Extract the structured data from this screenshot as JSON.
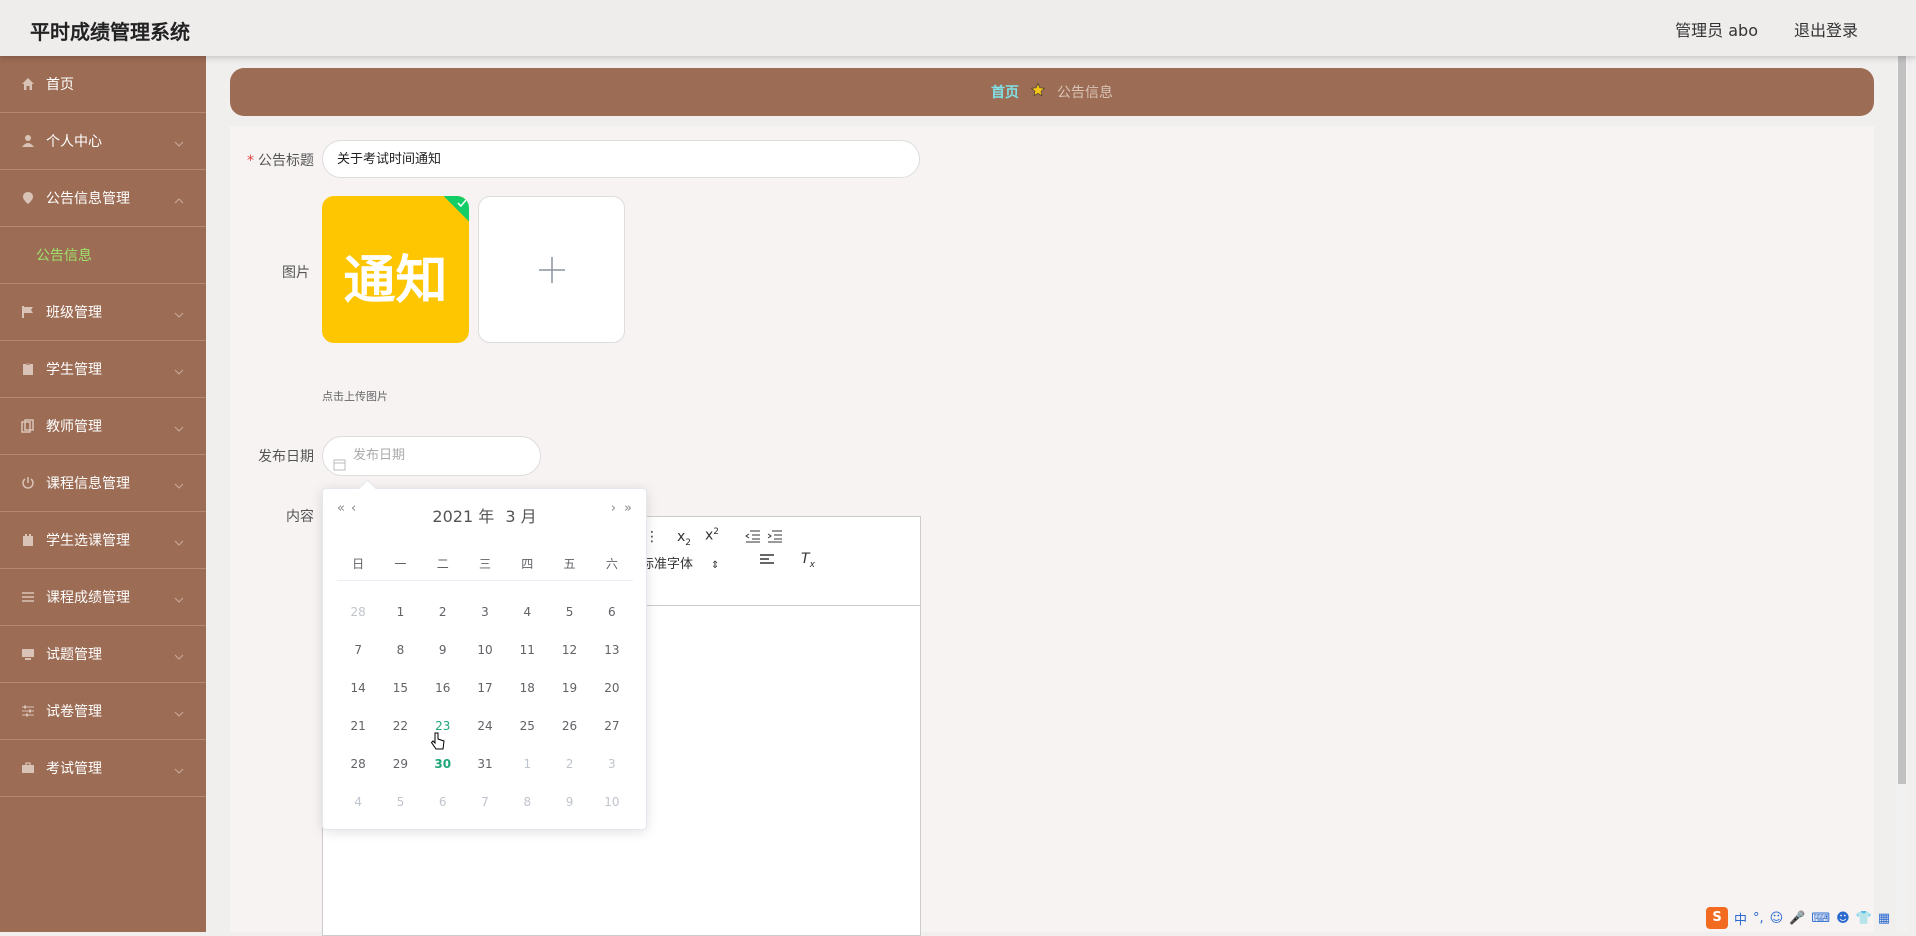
{
  "header": {
    "title": "平时成绩管理系统",
    "user": "管理员 abo",
    "logout": "退出登录"
  },
  "sidebar": {
    "items": [
      {
        "label": "首页",
        "icon": "home-icon"
      },
      {
        "label": "个人中心",
        "icon": "user-icon"
      },
      {
        "label": "公告信息管理",
        "icon": "location-icon",
        "expanded": true,
        "sub": "公告信息"
      },
      {
        "label": "班级管理",
        "icon": "flag-icon"
      },
      {
        "label": "学生管理",
        "icon": "clipboard-icon"
      },
      {
        "label": "教师管理",
        "icon": "copy-icon"
      },
      {
        "label": "课程信息管理",
        "icon": "power-icon"
      },
      {
        "label": "学生选课管理",
        "icon": "calendar-icon"
      },
      {
        "label": "课程成绩管理",
        "icon": "list-icon"
      },
      {
        "label": "试题管理",
        "icon": "monitor-icon"
      },
      {
        "label": "试卷管理",
        "icon": "sliders-icon"
      },
      {
        "label": "考试管理",
        "icon": "briefcase-icon"
      }
    ]
  },
  "breadcrumb": {
    "home": "首页",
    "current": "公告信息"
  },
  "form": {
    "title_label": "公告标题",
    "title_value": "关于考试时间通知",
    "image_label": "图片",
    "image_text": "通知",
    "upload_tip": "点击上传图片",
    "date_label": "发布日期",
    "date_placeholder": "发布日期",
    "content_label": "内容",
    "font_select": "标准字体"
  },
  "picker": {
    "year_label": "2021 年",
    "month_label": "3 月",
    "weekdays": [
      "日",
      "一",
      "二",
      "三",
      "四",
      "五",
      "六"
    ],
    "weeks": [
      [
        "28",
        "1",
        "2",
        "3",
        "4",
        "5",
        "6"
      ],
      [
        "7",
        "8",
        "9",
        "10",
        "11",
        "12",
        "13"
      ],
      [
        "14",
        "15",
        "16",
        "17",
        "18",
        "19",
        "20"
      ],
      [
        "21",
        "22",
        "23",
        "24",
        "25",
        "26",
        "27"
      ],
      [
        "28",
        "29",
        "30",
        "31",
        "1",
        "2",
        "3"
      ],
      [
        "4",
        "5",
        "6",
        "7",
        "8",
        "9",
        "10"
      ]
    ],
    "today": "23",
    "selected": "30"
  },
  "ime": {
    "label": "中"
  },
  "colors": {
    "sidebar": "#9c6c54",
    "accent": "#1fa67a",
    "submenu_active": "#9ee26a",
    "breadcrumb_home": "#7fe0e6"
  }
}
